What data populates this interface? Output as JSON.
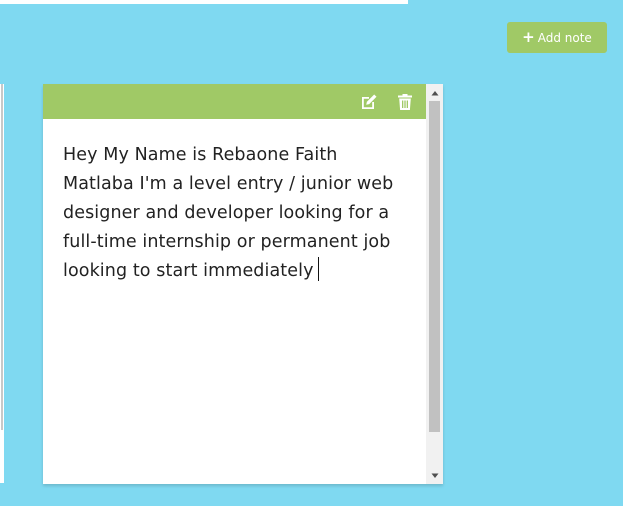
{
  "header": {
    "add_note_label": "Add note"
  },
  "note": {
    "text": "Hey My Name is Rebaone Faith Matlaba I'm a level entry / junior web designer and developer looking for a full-time internship or permanent job looking to start immediately",
    "icons": [
      "edit-icon",
      "trash-icon"
    ]
  },
  "colors": {
    "background": "#7fd9f1",
    "accent": "#a0c966",
    "note_bg": "#ffffff"
  }
}
